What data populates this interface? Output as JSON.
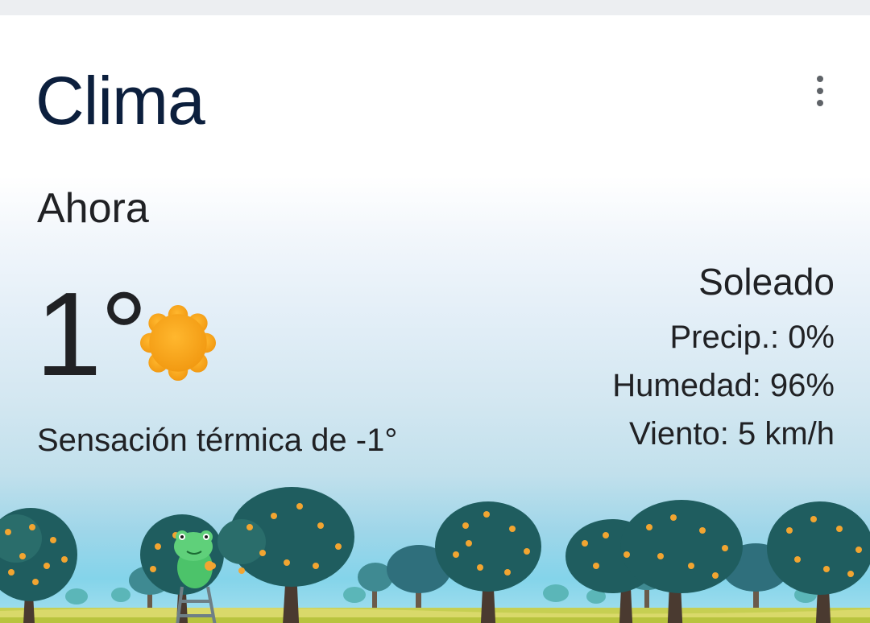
{
  "header": {
    "title": "Clima",
    "menu_icon": "more-vert-icon"
  },
  "current": {
    "label": "Ahora",
    "temperature": "1°",
    "condition_icon": "sun-icon",
    "feels_like": "Sensación térmica de -1°",
    "condition": "Soleado",
    "precipitation": "Precip.: 0%",
    "humidity": "Humedad: 96%",
    "wind": "Viento: 5 km/h"
  },
  "colors": {
    "title": "#0c1f3d",
    "text": "#202124",
    "sun": "#f6a51d",
    "sky_bottom": "#84d4ea",
    "foliage": "#245a5c",
    "grass": "#c6cf52"
  }
}
